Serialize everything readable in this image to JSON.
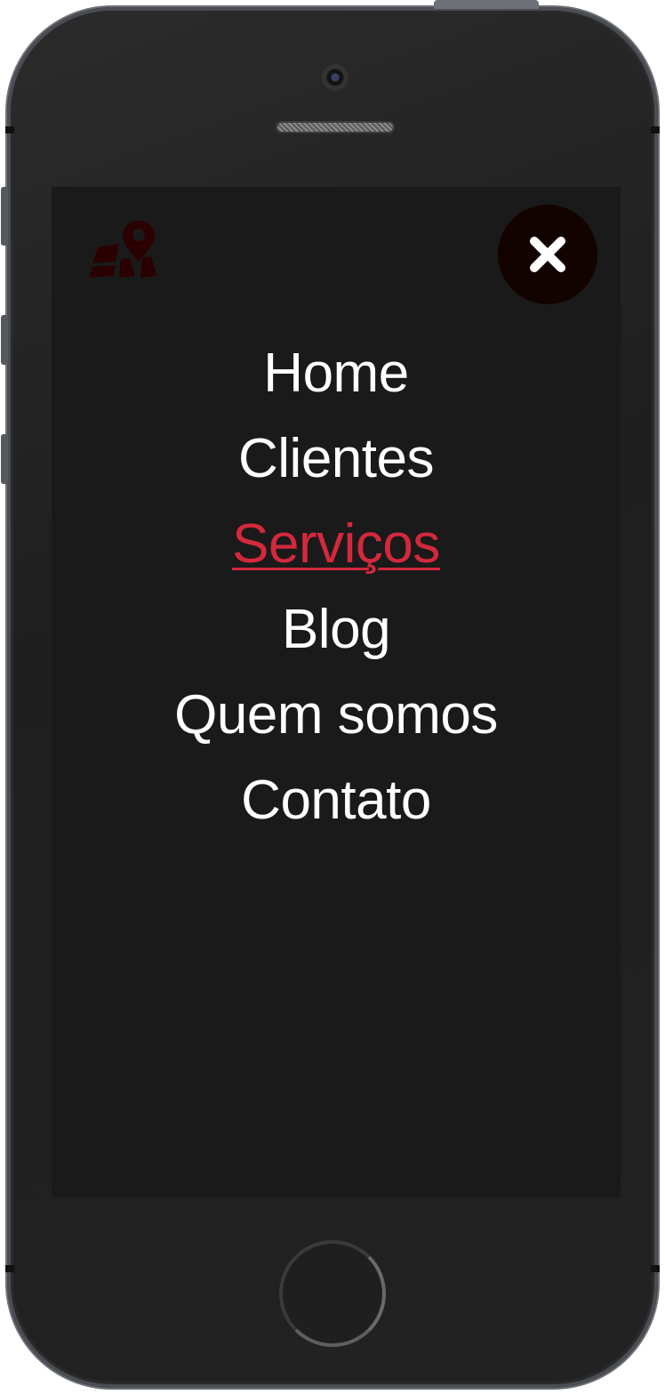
{
  "device": {
    "frame_color": "#222222",
    "screen_color": "#1a1a1a"
  },
  "header": {
    "logo_icon": "map-pin-icon",
    "logo_color": "#2a0000",
    "close_icon": "close-icon",
    "close_bg": "#120300"
  },
  "nav": {
    "items": [
      {
        "label": "Home",
        "active": false
      },
      {
        "label": "Clientes",
        "active": false
      },
      {
        "label": "Serviços",
        "active": true
      },
      {
        "label": "Blog",
        "active": false
      },
      {
        "label": "Quem somos",
        "active": false
      },
      {
        "label": "Contato",
        "active": false
      }
    ],
    "text_color": "#ffffff",
    "active_color": "#d4283c"
  }
}
